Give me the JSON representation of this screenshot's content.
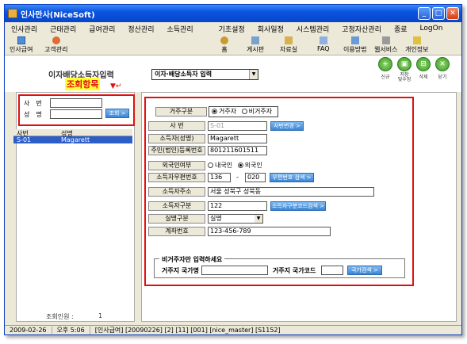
{
  "window": {
    "title": "인사만사(NiceSoft)"
  },
  "menu": [
    "인사관리",
    "근태관리",
    "급여관리",
    "정산관리",
    "소득관리",
    "기초설정",
    "회사일정",
    "시스템관리",
    "고정자산관리",
    "종료",
    "LogOn"
  ],
  "toolbar": {
    "left": [
      {
        "label": "인사급여",
        "icon": "payroll-icon"
      },
      {
        "label": "고객관리",
        "icon": "customer-icon"
      }
    ],
    "right": [
      {
        "label": "홈",
        "icon": "home-icon"
      },
      {
        "label": "게시판",
        "icon": "board-icon"
      },
      {
        "label": "자료실",
        "icon": "archive-icon"
      },
      {
        "label": "FAQ",
        "icon": "faq-icon"
      },
      {
        "label": "이용방법",
        "icon": "help-icon"
      },
      {
        "label": "웹서비스",
        "icon": "web-icon"
      },
      {
        "label": "개인정보",
        "icon": "privacy-icon"
      }
    ]
  },
  "page": {
    "title": "이자배당소득자입력",
    "annotation": "조회항목",
    "combo_value": "이자·배당소득자 입력"
  },
  "actions": [
    {
      "label": "신규",
      "icon": "new-icon"
    },
    {
      "label": "저장\n및수정",
      "icon": "save-icon"
    },
    {
      "label": "삭제",
      "icon": "delete-icon"
    },
    {
      "label": "닫기",
      "icon": "close-icon"
    }
  ],
  "search": {
    "code_label": "사　번",
    "name_label": "성　명",
    "code_value": "",
    "name_value": "",
    "button": "조회 >"
  },
  "list": {
    "headers": [
      "사번",
      "성명"
    ],
    "rows": [
      [
        "S-01",
        "Magarett"
      ]
    ],
    "footer_label": "조회인원 :",
    "footer_count": "1"
  },
  "form": {
    "resident_type_label": "거주구분",
    "resident_options": [
      "거주자",
      "비거주자"
    ],
    "emp_no_label": "사 번",
    "emp_no_value": "S-01",
    "emp_no_button": "사번변경 >",
    "name_label": "소득자(성명)",
    "name_value": "Magarett",
    "reg_no_label": "주민(법인)등록번호",
    "reg_no_value": "801211601511",
    "foreigner_label": "외국인여부",
    "foreigner_options": [
      "내국인",
      "외국인"
    ],
    "zip_label": "소득자우편번호",
    "zip1": "136",
    "zip_dash": "-",
    "zip2": "020",
    "zip_button": "우편번호 검색 >",
    "address_label": "소득자주소",
    "address_value": "서울 성북구 성북동",
    "income_type_label": "소득자구분",
    "income_type_value": "122",
    "income_type_button": "소득자구분코드검색 >",
    "real_name_label": "실명구분",
    "real_name_value": "실명",
    "account_label": "계좌번호",
    "account_value": "123-456-789",
    "nonres_legend": "비거주자만 입력하세요",
    "country_name_label": "거주지 국가명",
    "country_name_value": "",
    "country_code_label": "거주지 국가코드",
    "country_code_value": "",
    "country_button": "국가검색 >"
  },
  "status": [
    "2009-02-26",
    "오후 5:06",
    "[인사급여] [20090226] [2] [11] [001] [nice_master] [S1152]"
  ]
}
